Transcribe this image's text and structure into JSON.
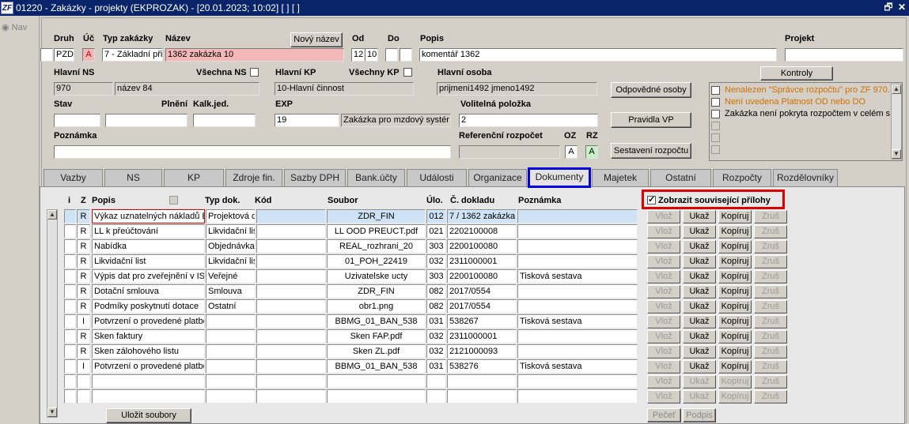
{
  "window": {
    "logo": "ZF",
    "title": "01220 - Zakázky - projekty (EKPROZAK) - [20.01.2023; 10:02]  [ ] [ ]",
    "restore_glyph": "🗗",
    "close_glyph": "✕"
  },
  "nav_label": "Nav",
  "header": {
    "labels": {
      "druh": "Druh",
      "uc": "Úč",
      "typ_zakazky": "Typ zakázky",
      "nazev": "Název",
      "od": "Od",
      "do": "Do",
      "popis": "Popis",
      "projekt": "Projekt",
      "hlavni_ns": "Hlavní NS",
      "vsechna_ns": "Všechna NS",
      "hlavni_kp": "Hlavní KP",
      "vsechny_kp": "Všechny KP",
      "hlavni_osoba": "Hlavní osoba",
      "stav": "Stav",
      "plneni": "Plnění",
      "kalk_jed": "Kalk.jed.",
      "exp": "EXP",
      "volitelna": "Volitelná položka",
      "poznamka": "Poznámka",
      "ref_rozpocet": "Referenční rozpočet",
      "oz": "OZ",
      "rz": "RZ"
    },
    "values": {
      "druh": "PZD",
      "uc": "A",
      "typ_zakazky": "7 - Základní při",
      "nazev": "1362 zakázka 10",
      "od": "12",
      "od2": "10",
      "do": "",
      "do2": "",
      "popis": "komentář 1362",
      "projekt": "",
      "hlavni_ns": "970",
      "hlavni_ns_nazev": "název 84",
      "hlavni_kp": "10-Hlavní činnost",
      "hlavni_osoba": "prijmeni1492 jmeno1492",
      "stav": "",
      "plneni": "",
      "kalk_jed": "",
      "exp": "19",
      "exp_text": "Zakázka pro mzdový systér",
      "volitelna": "2",
      "poznamka": "",
      "ref_rozpocet": "",
      "oz": "A",
      "rz": "A"
    },
    "buttons": {
      "novy_nazev": "Nový název",
      "kontroly": "Kontroly",
      "odpovedne_osoby": "Odpovědné osoby",
      "pravidla_vp": "Pravidla VP",
      "sestaveni_rozpoctu": "Sestavení rozpočtu"
    },
    "kontroly": [
      {
        "text": "Nenalezen \"Správce rozpočtu\" pro ZF 970.",
        "color": "#d07000"
      },
      {
        "text": "Není uvedena Platnost OD nebo DO",
        "color": "#d07000"
      },
      {
        "text": "Zakázka není pokryta rozpočtem v celém s",
        "color": "#000000"
      },
      {
        "text": "",
        "color": "#000000"
      },
      {
        "text": "",
        "color": "#000000"
      },
      {
        "text": "",
        "color": "#000000"
      }
    ]
  },
  "tabs": [
    "Vazby",
    "NS",
    "KP",
    "Zdroje fin.",
    "Sazby DPH",
    "Bank.účty",
    "Události",
    "Organizace",
    "Dokumenty",
    "Majetek",
    "Ostatní",
    "Rozpočty",
    "Rozdělovníky"
  ],
  "active_tab": "Dokumenty",
  "documents": {
    "columns": {
      "i": "i",
      "z": "Z",
      "popis": "Popis",
      "typ": "Typ dok.",
      "kod": "Kód",
      "soubor": "Soubor",
      "ulo": "Úlo.",
      "cislo": "Č. dokladu",
      "poznamka": "Poznámka"
    },
    "show_related_label": "Zobrazit související přílohy",
    "row_buttons": {
      "vloz": "Vlož",
      "ukaz": "Ukaž",
      "kopiruj": "Kopíruj",
      "zrus": "Zruš"
    },
    "rows": [
      {
        "i": "",
        "z": "R",
        "popis": "Výkaz uznatelných nákladů E",
        "typ": "Projektová d",
        "kod": "",
        "soubor": "ZDR_FIN",
        "ulo": "012",
        "cislo": "7 / 1362 zakázka",
        "poznamka": ""
      },
      {
        "i": "",
        "z": "R",
        "popis": "LL k přeúčtování",
        "typ": "Likvidační lis",
        "kod": "",
        "soubor": "LL OOD PREUCT.pdf",
        "ulo": "021",
        "cislo": "2202100008",
        "poznamka": ""
      },
      {
        "i": "",
        "z": "R",
        "popis": "Nabídka",
        "typ": "Objednávka",
        "kod": "",
        "soubor": "REAL_rozhrani_20",
        "ulo": "303",
        "cislo": "2200100080",
        "poznamka": ""
      },
      {
        "i": "",
        "z": "R",
        "popis": "Likvidační list",
        "typ": "Likvidační lis",
        "kod": "",
        "soubor": "01_POH_22419",
        "ulo": "032",
        "cislo": "2311000001",
        "poznamka": ""
      },
      {
        "i": "",
        "z": "R",
        "popis": "Výpis dat pro zveřejnění v IS",
        "typ": "Veřejné",
        "kod": "",
        "soubor": "Uzivatelske ucty",
        "ulo": "303",
        "cislo": "2200100080",
        "poznamka": "Tisková sestava"
      },
      {
        "i": "",
        "z": "R",
        "popis": "Dotační smlouva",
        "typ": "Smlouva",
        "kod": "",
        "soubor": "ZDR_FIN",
        "ulo": "082",
        "cislo": "2017/0554",
        "poznamka": ""
      },
      {
        "i": "",
        "z": "R",
        "popis": "Podmíky poskytnutí dotace",
        "typ": "Ostatní",
        "kod": "",
        "soubor": "obr1.png",
        "ulo": "082",
        "cislo": "2017/0554",
        "poznamka": ""
      },
      {
        "i": "",
        "z": "I",
        "popis": "Potvrzení o provedené platbě",
        "typ": "",
        "kod": "",
        "soubor": "BBMG_01_BAN_538",
        "ulo": "031",
        "cislo": "538267",
        "poznamka": "Tisková sestava"
      },
      {
        "i": "",
        "z": "R",
        "popis": "Sken faktury",
        "typ": "",
        "kod": "",
        "soubor": "Sken FAP.pdf",
        "ulo": "032",
        "cislo": "2311000001",
        "poznamka": ""
      },
      {
        "i": "",
        "z": "R",
        "popis": "Sken zálohového listu",
        "typ": "",
        "kod": "",
        "soubor": "Sken ZL.pdf",
        "ulo": "032",
        "cislo": "2121000093",
        "poznamka": ""
      },
      {
        "i": "",
        "z": "I",
        "popis": "Potvrzení o provedené platbě",
        "typ": "",
        "kod": "",
        "soubor": "BBMG_01_BAN_538",
        "ulo": "031",
        "cislo": "538276",
        "poznamka": "Tisková sestava"
      },
      {
        "i": "",
        "z": "",
        "popis": "",
        "typ": "",
        "kod": "",
        "soubor": "",
        "ulo": "",
        "cislo": "",
        "poznamka": ""
      },
      {
        "i": "",
        "z": "",
        "popis": "",
        "typ": "",
        "kod": "",
        "soubor": "",
        "ulo": "",
        "cislo": "",
        "poznamka": ""
      }
    ],
    "ulozit_soubory": "Uložit soubory",
    "pecet": "Pečeť",
    "podpis": "Podpis"
  }
}
